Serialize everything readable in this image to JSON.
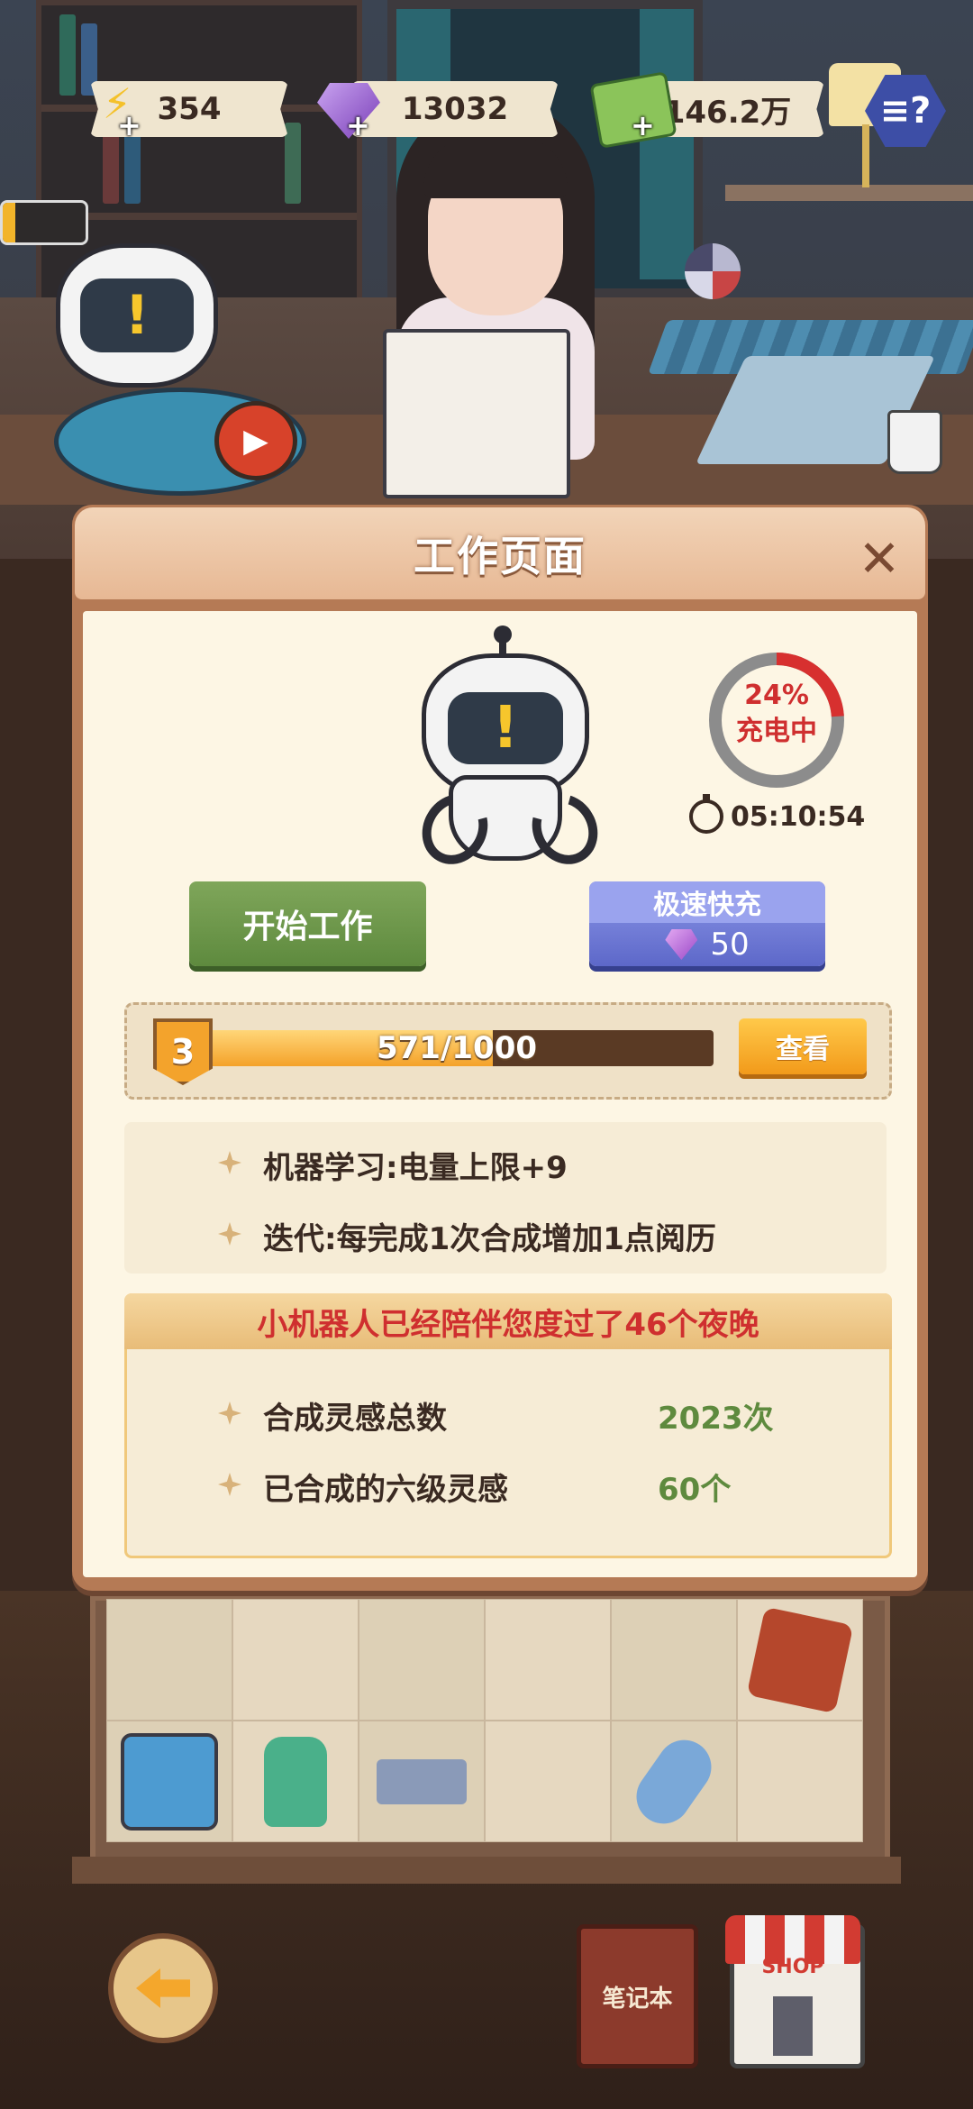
{
  "hud": {
    "energy": "354",
    "gems": "13032",
    "money": "146.2万",
    "plus": "+",
    "help_icon": "notes-question-icon",
    "battery_level": 0.15
  },
  "dialog": {
    "title": "工作页面",
    "close_icon": "close-icon",
    "gauge_percent_value": 24,
    "gauge_percent": "24%",
    "gauge_status": "充电中",
    "timer": "05:10:54",
    "start_work_label": "开始工作",
    "fast_charge_label": "极速快充",
    "fast_charge_cost": "50",
    "level": "3",
    "xp_current": 571,
    "xp_max": 1000,
    "xp_text": "571/1000",
    "view_label": "查看",
    "bonuses": [
      "机器学习:电量上限+9",
      "迭代:每完成1次合成增加1点阅历"
    ],
    "companion_banner": "小机器人已经陪伴您度过了46个夜晚",
    "stats": [
      {
        "label": "合成灵感总数",
        "value": "2023次"
      },
      {
        "label": "已合成的六级灵感",
        "value": "60个"
      }
    ]
  },
  "bottom": {
    "notebook_label": "笔记本",
    "shop_label": "SHOP"
  },
  "colors": {
    "accent_red": "#cf2f2f",
    "accent_green": "#5e8a3e",
    "panel": "#fdf6e4"
  }
}
